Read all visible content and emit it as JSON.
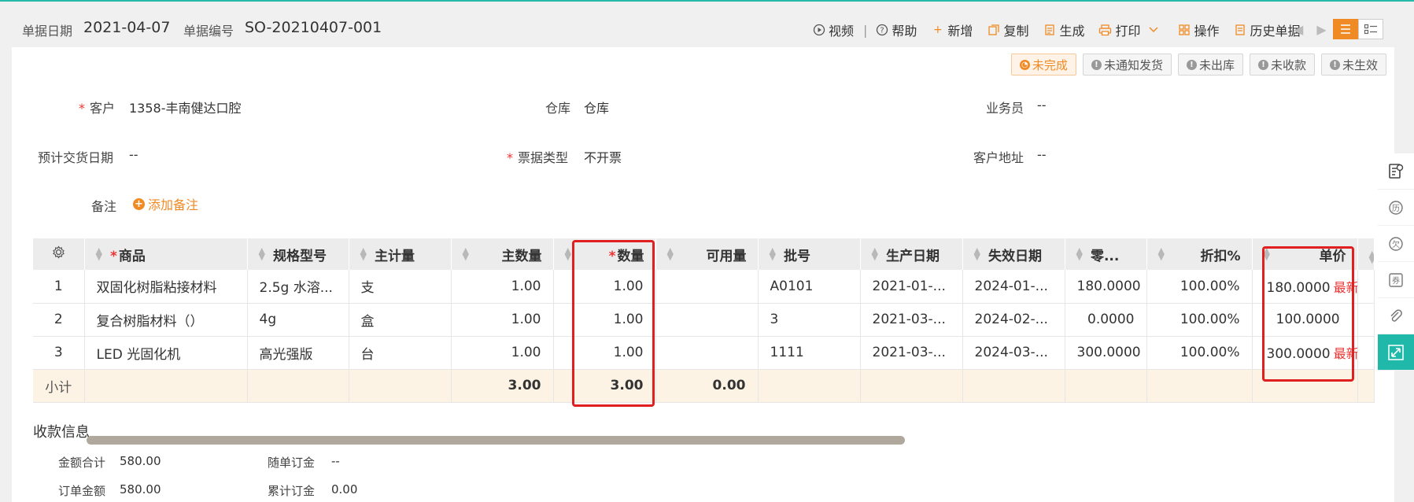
{
  "header": {
    "date_label": "单据日期",
    "date_value": "2021-04-07",
    "number_label": "单据编号",
    "number_value": "SO-20210407-001"
  },
  "toolbar": {
    "video": "视频",
    "help": "帮助",
    "add": "新增",
    "copy": "复制",
    "generate": "生成",
    "print": "打印",
    "operate": "操作",
    "history": "历史单据"
  },
  "status_tags": [
    "未完成",
    "未通知发货",
    "未出库",
    "未收款",
    "未生效"
  ],
  "form": {
    "customer_label": "客户",
    "customer_value": "1358-丰南健达口腔",
    "warehouse_label": "仓库",
    "warehouse_value": "仓库",
    "salesman_label": "业务员",
    "salesman_value": "--",
    "delivery_label": "预计交货日期",
    "delivery_value": "--",
    "invoice_label": "票据类型",
    "invoice_value": "不开票",
    "address_label": "客户地址",
    "address_value": "--",
    "note_label": "备注",
    "note_add": "添加备注"
  },
  "table": {
    "headers": {
      "product": "商品",
      "spec": "规格型号",
      "unit": "主计量",
      "main_qty": "主数量",
      "qty": "数量",
      "available": "可用量",
      "batch": "批号",
      "prod_date": "生产日期",
      "exp_date": "失效日期",
      "retail": "零...",
      "discount": "折扣%",
      "price": "单价"
    },
    "rows": [
      {
        "no": "1",
        "product": "双固化树脂粘接材料",
        "spec": "2.5g 水溶...",
        "unit": "支",
        "main_qty": "1.00",
        "qty": "1.00",
        "available": "",
        "batch": "A0101",
        "prod_date": "2021-01-...",
        "exp_date": "2024-01-...",
        "retail": "180.0000",
        "discount": "100.00%",
        "price": "180.0000",
        "tag": "最新"
      },
      {
        "no": "2",
        "product": "复合树脂材料（）",
        "spec": "4g",
        "unit": "盒",
        "main_qty": "1.00",
        "qty": "1.00",
        "available": "",
        "batch": "3",
        "prod_date": "2021-03-...",
        "exp_date": "2024-02-...",
        "retail": "0.0000",
        "discount": "100.00%",
        "price": "100.0000",
        "tag": ""
      },
      {
        "no": "3",
        "product": "LED 光固化机",
        "spec": "高光强版",
        "unit": "台",
        "main_qty": "1.00",
        "qty": "1.00",
        "available": "",
        "batch": "1111",
        "prod_date": "2021-03-...",
        "exp_date": "2024-03-...",
        "retail": "300.0000",
        "discount": "100.00%",
        "price": "300.0000",
        "tag": "最新"
      }
    ],
    "subtotal": {
      "label": "小计",
      "main_qty": "3.00",
      "qty": "3.00",
      "available": "0.00"
    }
  },
  "payment": {
    "title": "收款信息",
    "total_label": "金额合计",
    "total_value": "580.00",
    "order_label": "订单金额",
    "order_value": "580.00",
    "deposit_label": "随单订金",
    "deposit_value": "--",
    "cum_label": "累计订金",
    "cum_value": "0.00"
  }
}
